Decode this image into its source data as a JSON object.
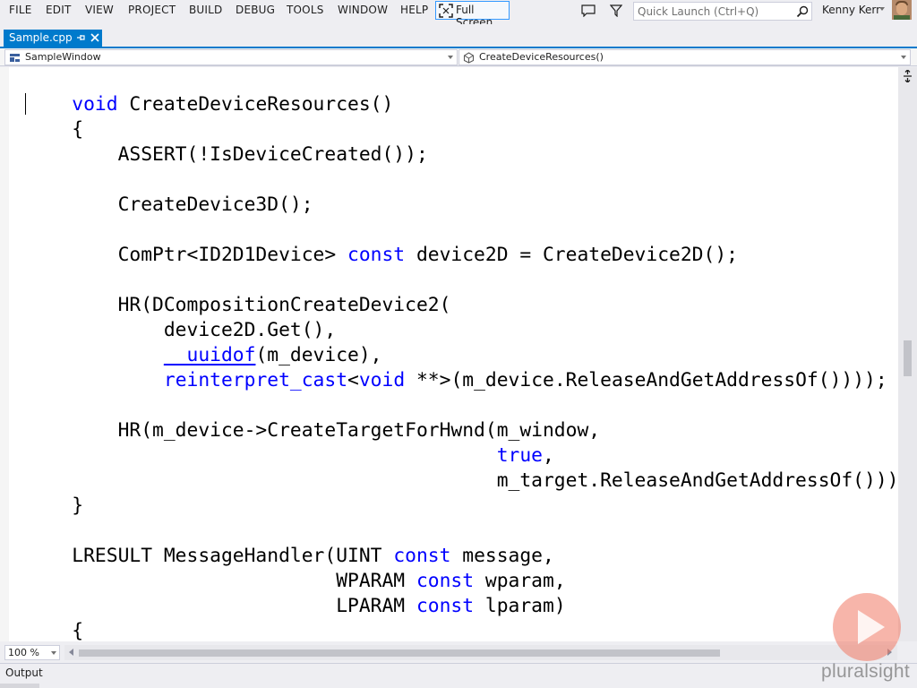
{
  "menu": {
    "items": [
      "FILE",
      "EDIT",
      "VIEW",
      "PROJECT",
      "BUILD",
      "DEBUG",
      "TOOLS",
      "WINDOW",
      "HELP"
    ],
    "fullscreen_label": "Full Screen",
    "quick_launch_placeholder": "Quick Launch (Ctrl+Q)",
    "user_name": "Kenny Kerr"
  },
  "tabs": {
    "active_label": "Sample.cpp"
  },
  "navbar": {
    "class_scope": "SampleWindow",
    "member_scope": "CreateDeviceResources()"
  },
  "editor": {
    "lines": [
      [
        [
          "kw",
          "    void"
        ],
        [
          "p",
          " CreateDeviceResources()"
        ]
      ],
      [
        [
          "p",
          "    {"
        ]
      ],
      [
        [
          "p",
          "        ASSERT(!IsDeviceCreated());"
        ]
      ],
      [
        [
          "p",
          ""
        ]
      ],
      [
        [
          "p",
          "        CreateDevice3D();"
        ]
      ],
      [
        [
          "p",
          ""
        ]
      ],
      [
        [
          "p",
          "        ComPtr<ID2D1Device> "
        ],
        [
          "kw",
          "const"
        ],
        [
          "p",
          " device2D = CreateDevice2D();"
        ]
      ],
      [
        [
          "p",
          ""
        ]
      ],
      [
        [
          "p",
          "        HR(DCompositionCreateDevice2("
        ]
      ],
      [
        [
          "p",
          "            device2D.Get(),"
        ]
      ],
      [
        [
          "p",
          "            "
        ],
        [
          "uuid",
          "__uuidof"
        ],
        [
          "p",
          "(m_device),"
        ]
      ],
      [
        [
          "p",
          "            "
        ],
        [
          "kw",
          "reinterpret_cast"
        ],
        [
          "p",
          "<"
        ],
        [
          "kw",
          "void"
        ],
        [
          "p",
          " **>(m_device.ReleaseAndGetAddressOf())));"
        ]
      ],
      [
        [
          "p",
          ""
        ]
      ],
      [
        [
          "p",
          "        HR(m_device->CreateTargetForHwnd(m_window,"
        ]
      ],
      [
        [
          "p",
          "                                         "
        ],
        [
          "kw",
          "true"
        ],
        [
          "p",
          ","
        ]
      ],
      [
        [
          "p",
          "                                         m_target.ReleaseAndGetAddressOf()));"
        ]
      ],
      [
        [
          "p",
          "    }"
        ]
      ],
      [
        [
          "p",
          ""
        ]
      ],
      [
        [
          "p",
          "    LRESULT MessageHandler(UINT "
        ],
        [
          "kw",
          "const"
        ],
        [
          "p",
          " message,"
        ]
      ],
      [
        [
          "p",
          "                           WPARAM "
        ],
        [
          "kw",
          "const"
        ],
        [
          "p",
          " wparam,"
        ]
      ],
      [
        [
          "p",
          "                           LPARAM "
        ],
        [
          "kw",
          "const"
        ],
        [
          "p",
          " lparam)"
        ]
      ],
      [
        [
          "p",
          "    {"
        ]
      ]
    ]
  },
  "status": {
    "zoom": "100 %",
    "output_label": "Output"
  },
  "branding": {
    "watermark": "pluralsight"
  },
  "colors": {
    "accent": "#007ACC",
    "keyword": "#0000FF",
    "text": "#000000"
  }
}
